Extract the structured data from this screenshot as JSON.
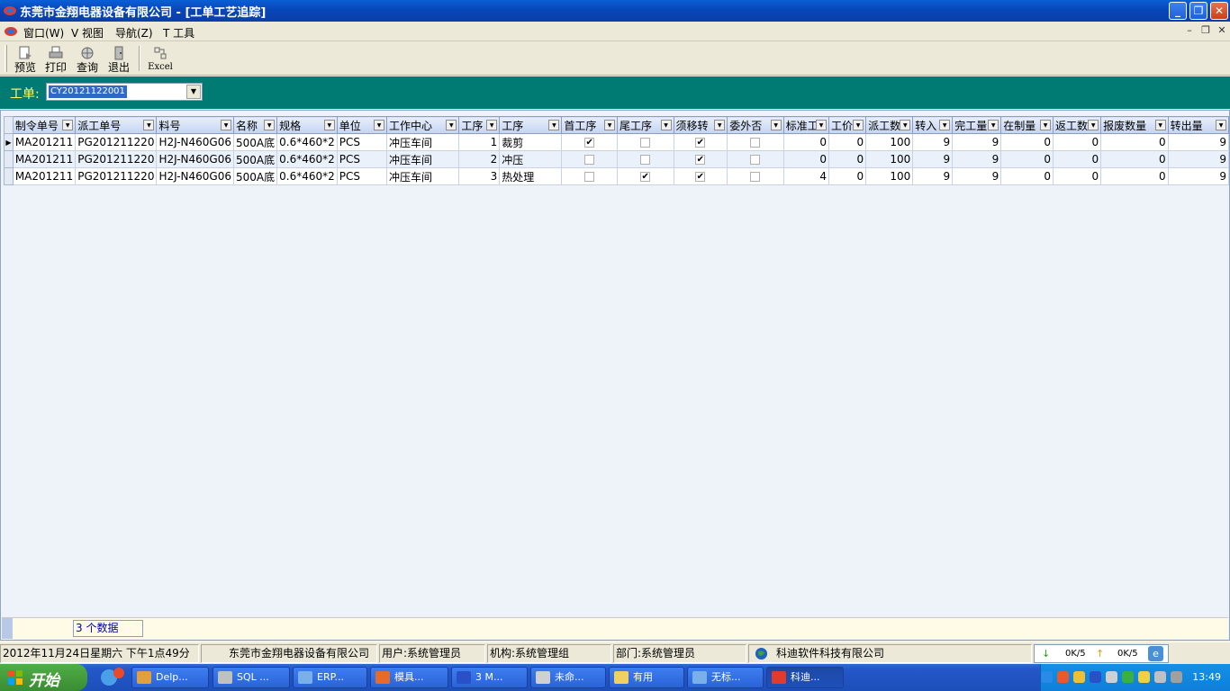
{
  "window": {
    "title": "东莞市金翔电器设备有限公司 - [工单工艺追踪]",
    "minimize": "_",
    "restore": "❐",
    "close": "✕"
  },
  "menu": {
    "items": [
      "窗口(W)",
      "V 视图",
      "导航(Z)",
      "T 工具"
    ],
    "mdi_min": "–",
    "mdi_restore": "❐",
    "mdi_close": "✕"
  },
  "toolbar": {
    "preview": "预览",
    "print": "打印",
    "query": "查询",
    "exit": "退出",
    "excel": "Excel"
  },
  "filter": {
    "label": "工单:",
    "value": "CY20121122001",
    "arrow": "▼"
  },
  "grid": {
    "columns": [
      "制令单号",
      "派工单号",
      "料号",
      "名称",
      "规格",
      "单位",
      "工作中心",
      "工序",
      "工序",
      "首工序",
      "尾工序",
      "须移转",
      "委外否",
      "标准工",
      "工价",
      "派工数",
      "转入",
      "完工量",
      "在制量",
      "返工数",
      "报废数量",
      "转出量"
    ],
    "dropdown": "▼",
    "current_marker": "▶",
    "rows": [
      {
        "mo": "MA201211",
        "wo": "PG201211220",
        "part": "H2J-N460G06",
        "name": "500A底",
        "spec": "0.6*460*2",
        "unit": "PCS",
        "center": "冲压车间",
        "seq": "1",
        "op": "裁剪",
        "first": true,
        "last": false,
        "transfer": true,
        "outsource": false,
        "std": "0",
        "price": "0",
        "dispatch": "100",
        "in": "9",
        "done": "9",
        "wip": "0",
        "rework": "0",
        "scrap": "0",
        "out": "9"
      },
      {
        "mo": "MA201211",
        "wo": "PG201211220",
        "part": "H2J-N460G06",
        "name": "500A底",
        "spec": "0.6*460*2",
        "unit": "PCS",
        "center": "冲压车间",
        "seq": "2",
        "op": "冲压",
        "first": false,
        "last": false,
        "transfer": true,
        "outsource": false,
        "std": "0",
        "price": "0",
        "dispatch": "100",
        "in": "9",
        "done": "9",
        "wip": "0",
        "rework": "0",
        "scrap": "0",
        "out": "9"
      },
      {
        "mo": "MA201211",
        "wo": "PG201211220",
        "part": "H2J-N460G06",
        "name": "500A底",
        "spec": "0.6*460*2",
        "unit": "PCS",
        "center": "冲压车间",
        "seq": "3",
        "op": "热处理",
        "first": false,
        "last": true,
        "transfer": true,
        "outsource": false,
        "std": "4",
        "price": "0",
        "dispatch": "100",
        "in": "9",
        "done": "9",
        "wip": "0",
        "rework": "0",
        "scrap": "0",
        "out": "9"
      }
    ],
    "record_count": "3 个数据"
  },
  "status": {
    "datetime": "2012年11月24日星期六 下午1点49分",
    "company": "东莞市金翔电器设备有限公司",
    "user": "用户:系统管理员",
    "org": "机构:系统管理组",
    "dept": "部门:系统管理员",
    "vendor": "科迪软件科技有限公司",
    "net_down": "0K/5",
    "net_up": "0K/5"
  },
  "taskbar": {
    "start": "开始",
    "tasks": [
      "Delp...",
      "SQL ...",
      "ERP...",
      "模具...",
      "3 M...",
      "未命...",
      "有用",
      "无标...",
      "科迪..."
    ],
    "clock": "13:49"
  },
  "colors": {
    "titlebar": "#0a4fc4",
    "filterbar": "#007b73",
    "filter_label": "#ffff66",
    "grid_bg": "#eef3fa",
    "taskbar": "#2457c8"
  }
}
